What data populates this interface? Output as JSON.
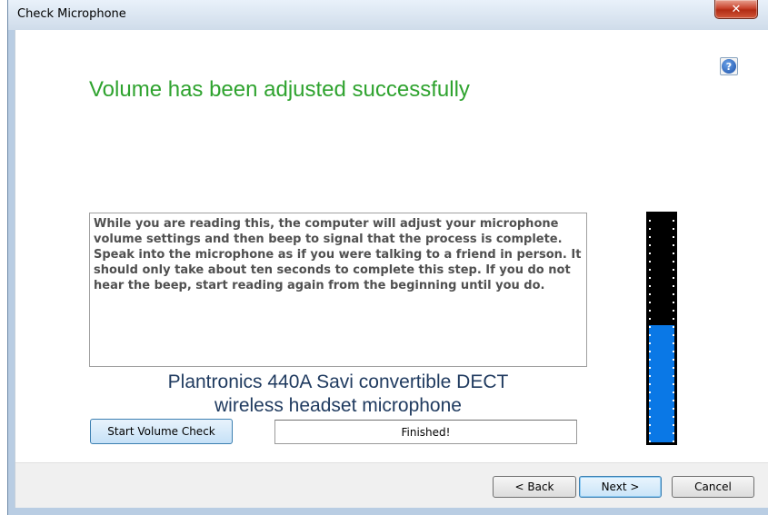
{
  "window": {
    "title": "Check Microphone",
    "close_glyph": "✕"
  },
  "help": {
    "glyph": "?"
  },
  "heading": "Volume has been adjusted successfully",
  "instructions": "While you are reading this, the computer will adjust your microphone volume settings and then beep to signal that the process is complete. Speak into the microphone as if you were talking to a friend in person. It should only take about ten seconds to complete this step. If you do not hear the beep, start reading again from the beginning until you do.",
  "device": {
    "line1": "Plantronics 440A Savi convertible DECT",
    "line2": "wireless headset microphone"
  },
  "volume_check": {
    "button_label": "Start Volume Check",
    "status": "Finished!"
  },
  "level_meter": {
    "level_fraction": 0.51,
    "fill_color": "#0a78e6",
    "background_color": "#000000"
  },
  "footer": {
    "back_label": "< Back",
    "next_label": "Next >",
    "cancel_label": "Cancel"
  },
  "colors": {
    "heading": "#2fa32f",
    "device_text": "#1f3a5f"
  }
}
